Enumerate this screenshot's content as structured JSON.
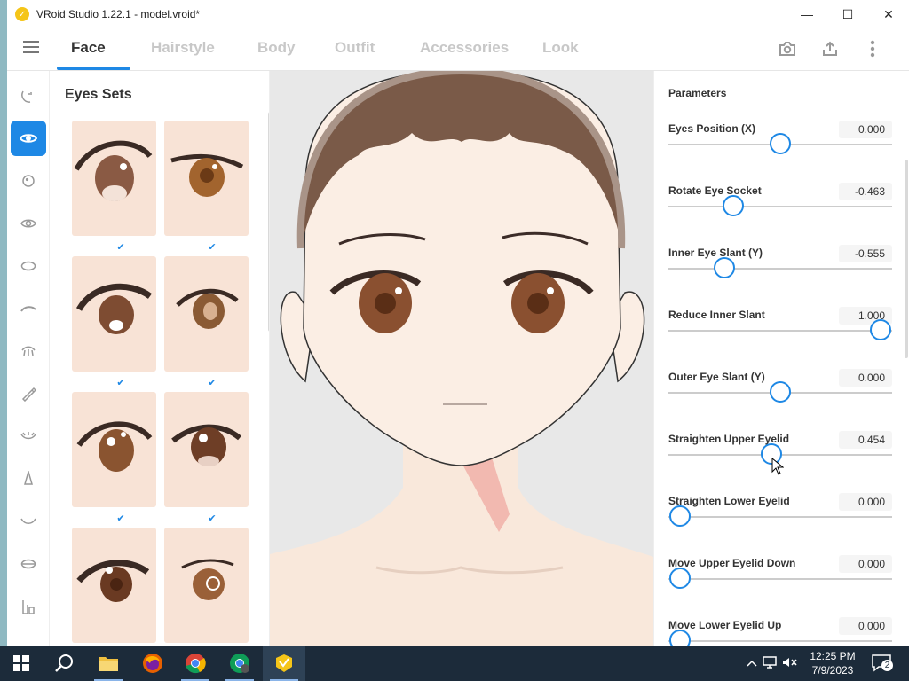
{
  "window": {
    "title": "VRoid Studio 1.22.1 - model.vroid*",
    "controls": {
      "minimize": "—",
      "maximize": "☐",
      "close": "✕"
    }
  },
  "tabs": [
    {
      "label": "Face",
      "active": true
    },
    {
      "label": "Hairstyle",
      "active": false
    },
    {
      "label": "Body",
      "active": false
    },
    {
      "label": "Outfit",
      "active": false
    },
    {
      "label": "Accessories",
      "active": false
    },
    {
      "label": "Look",
      "active": false
    }
  ],
  "toolbar_icons": [
    "camera-icon",
    "export-icon",
    "more-vert-icon"
  ],
  "rail": {
    "items": [
      {
        "icon": "face-icon",
        "active": false
      },
      {
        "icon": "eye-icon",
        "active": true
      },
      {
        "icon": "iris-icon",
        "active": false
      },
      {
        "icon": "eye-highlight-icon",
        "active": false
      },
      {
        "icon": "eye-white-icon",
        "active": false
      },
      {
        "icon": "eyebrow-icon",
        "active": false
      },
      {
        "icon": "eyelash-icon",
        "active": false
      },
      {
        "icon": "eyeliner-icon",
        "active": false
      },
      {
        "icon": "lower-lash-icon",
        "active": false
      },
      {
        "icon": "nose-icon",
        "active": false
      },
      {
        "icon": "mouth-icon",
        "active": false
      },
      {
        "icon": "teeth-icon",
        "active": false
      },
      {
        "icon": "ear-icon",
        "active": false
      }
    ]
  },
  "eye_sets": {
    "title": "Eyes Sets",
    "check_glyph": "✔"
  },
  "parameters": {
    "title": "Parameters",
    "items": [
      {
        "label": "Eyes Position (X)",
        "value": "0.000",
        "level": 0.5
      },
      {
        "label": "Rotate Eye Socket",
        "value": "-0.463",
        "level": 0.29
      },
      {
        "label": "Inner Eye Slant (Y)",
        "value": "-0.555",
        "level": 0.25
      },
      {
        "label": "Reduce Inner Slant",
        "value": "1.000",
        "level": 0.95
      },
      {
        "label": "Outer Eye Slant (Y)",
        "value": "0.000",
        "level": 0.5
      },
      {
        "label": "Straighten Upper Eyelid",
        "value": "0.454",
        "level": 0.46
      },
      {
        "label": "Straighten Lower Eyelid",
        "value": "0.000",
        "level": 0.05
      },
      {
        "label": "Move Upper Eyelid Down",
        "value": "0.000",
        "level": 0.05
      },
      {
        "label": "Move Lower Eyelid Up",
        "value": "0.000",
        "level": 0.05
      }
    ]
  },
  "taskbar": {
    "time": "12:25 PM",
    "date": "7/9/2023",
    "notification_count": "2",
    "apps": [
      "start-icon",
      "search-icon",
      "file-explorer-icon",
      "firefox-icon",
      "chrome-icon",
      "chrome-profile-icon",
      "vroid-studio-icon"
    ]
  }
}
